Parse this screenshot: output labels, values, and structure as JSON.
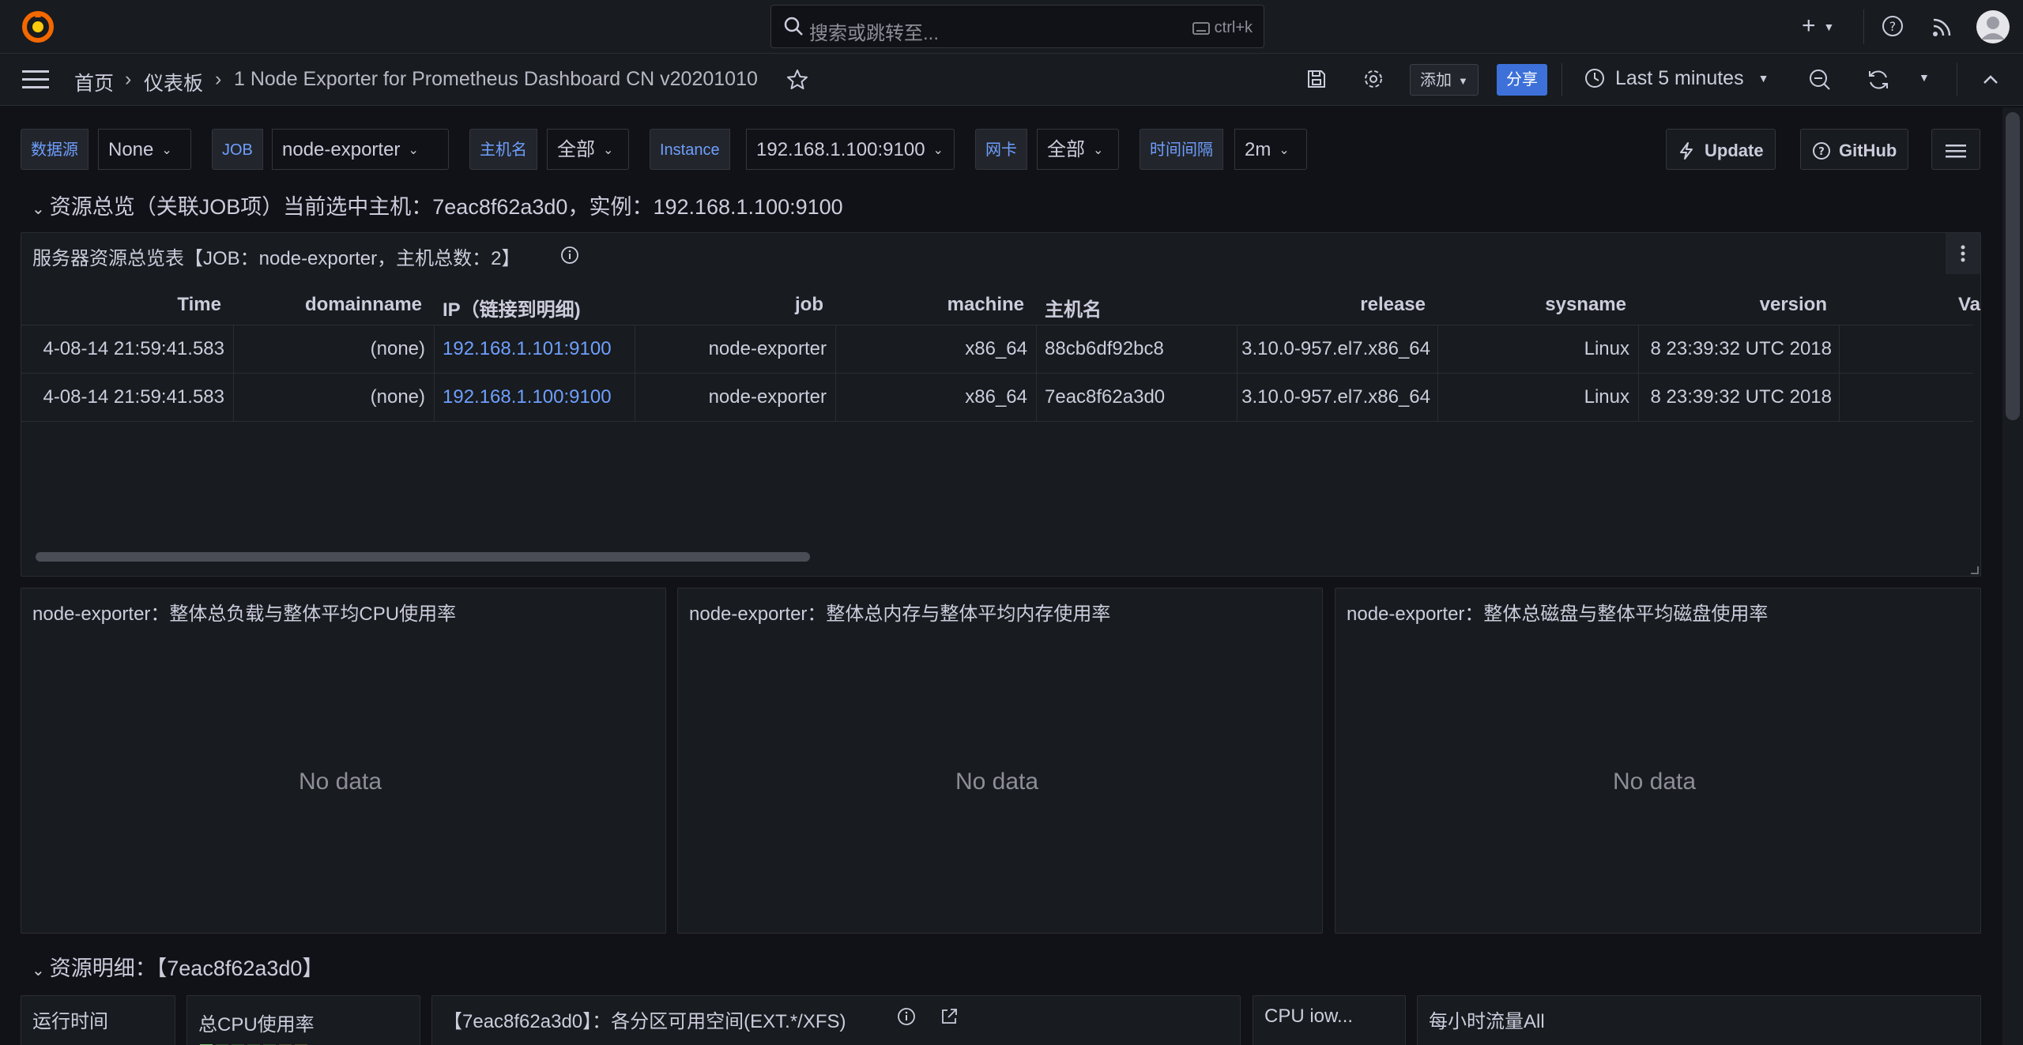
{
  "topbar": {
    "search_placeholder": "搜索或跳转至...",
    "search_shortcut": "ctrl+k",
    "plus_label": "+"
  },
  "breadcrumb": {
    "home": "首页",
    "dashboards": "仪表板",
    "current": "1 Node Exporter for Prometheus Dashboard CN v20201010"
  },
  "toolbar": {
    "add_label": "添加",
    "share_label": "分享",
    "time_range": "Last 5 minutes"
  },
  "variables": [
    {
      "label": "数据源",
      "value": "None"
    },
    {
      "label": "JOB",
      "value": "node-exporter"
    },
    {
      "label": "主机名",
      "value": "全部"
    },
    {
      "label": "Instance",
      "value": "192.168.1.100:9100"
    },
    {
      "label": "网卡",
      "value": "全部"
    },
    {
      "label": "时间间隔",
      "value": "2m"
    }
  ],
  "links": {
    "update": "Update",
    "github": "GitHub"
  },
  "row1": {
    "title": "资源总览（关联JOB项）当前选中主机：7eac8f62a3d0，实例：192.168.1.100:9100"
  },
  "table_panel": {
    "title": "服务器资源总览表【JOB：node-exporter，主机总数：2】",
    "columns": [
      "Time",
      "domainname",
      "IP（链接到明细)",
      "job",
      "machine",
      "主机名",
      "release",
      "sysname",
      "version",
      "Va"
    ],
    "rows": [
      [
        "4-08-14 21:59:41.583",
        "(none)",
        "192.168.1.101:9100",
        "node-exporter",
        "x86_64",
        "88cb6df92bc8",
        "3.10.0-957.el7.x86_64",
        "Linux",
        "8 23:39:32 UTC 2018"
      ],
      [
        "4-08-14 21:59:41.583",
        "(none)",
        "192.168.1.100:9100",
        "node-exporter",
        "x86_64",
        "7eac8f62a3d0",
        "3.10.0-957.el7.x86_64",
        "Linux",
        "8 23:39:32 UTC 2018"
      ]
    ]
  },
  "panels_mid": [
    {
      "title": "node-exporter：整体总负载与整体平均CPU使用率",
      "message": "No data"
    },
    {
      "title": "node-exporter：整体总内存与整体平均内存使用率",
      "message": "No data"
    },
    {
      "title": "node-exporter：整体总磁盘与整体平均磁盘使用率",
      "message": "No data"
    }
  ],
  "row2": {
    "title": "资源明细：【7eac8f62a3d0】"
  },
  "panels_bottom": [
    {
      "title": "运行时间"
    },
    {
      "title": "总CPU使用率"
    },
    {
      "title": "【7eac8f62a3d0】：各分区可用空间(EXT.*/XFS)"
    },
    {
      "title": "CPU iow..."
    },
    {
      "title": "每小时流量All"
    }
  ],
  "colors": {
    "background": "#111217",
    "panel": "#181b1f",
    "accent_blue": "#3d71d9",
    "link_blue": "#6e9fff",
    "logo_orange": "#f46800"
  }
}
